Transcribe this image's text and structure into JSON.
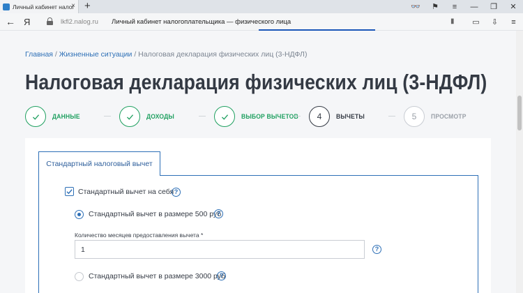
{
  "browser": {
    "tab_title": "Личный кабинет налогоплательщика — физического лица",
    "tab_close": "×",
    "new_tab": "+",
    "back": "←",
    "yandex": "Я",
    "url_domain": "lkfl2.nalog.ru",
    "url_title": "Личный кабинет налогоплательщика — физического лица",
    "bookmark": "▮",
    "top_icons": [
      "👓",
      "⚑",
      "≡",
      "—",
      "❐",
      "✕"
    ],
    "addr_icons": [
      "▭",
      "⇩",
      "≡"
    ]
  },
  "breadcrumb": {
    "items": [
      "Главная",
      "Жизненные ситуации"
    ],
    "current": "Налоговая декларация физических лиц (3-НДФЛ)",
    "separator": " / "
  },
  "page_title": "Налоговая декларация физических лиц (3-НДФЛ)",
  "steps": [
    {
      "num": "",
      "label": "ДАННЫЕ",
      "state": "done"
    },
    {
      "num": "",
      "label": "ДОХОДЫ",
      "state": "done"
    },
    {
      "num": "",
      "label": "ВЫБОР ВЫЧЕТОВ",
      "state": "done"
    },
    {
      "num": "4",
      "label": "ВЫЧЕТЫ",
      "state": "current"
    },
    {
      "num": "5",
      "label": "ПРОСМОТР",
      "state": "future"
    }
  ],
  "card": {
    "tab_label": "Стандартный налоговый вычет",
    "option_self": "Стандартный вычет на себя",
    "option_self_checked": true,
    "radio_500": "Стандартный вычет в размере 500 руб",
    "radio_500_checked": true,
    "months_label": "Количество месяцев предоставления вычета *",
    "months_value": "1",
    "radio_3000": "Стандартный вычет в размере 3000 руб",
    "radio_3000_checked": false,
    "help_glyph": "?"
  },
  "colors": {
    "accent_blue": "#2d6fb6",
    "done_green": "#1fa060",
    "title_dark": "#343a44"
  }
}
